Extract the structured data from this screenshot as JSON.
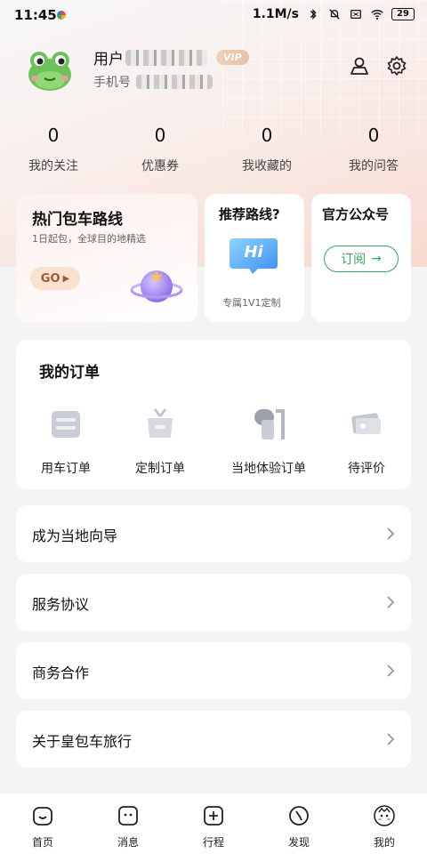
{
  "status_bar": {
    "time": "11:45",
    "network_speed": "1.1M/s",
    "battery": "29"
  },
  "profile": {
    "name_prefix": "用户",
    "vip_badge": "VIP",
    "phone_prefix": "手机号"
  },
  "stats": [
    {
      "value": "0",
      "label": "我的关注"
    },
    {
      "value": "0",
      "label": "优惠券"
    },
    {
      "value": "0",
      "label": "我收藏的"
    },
    {
      "value": "0",
      "label": "我的问答"
    }
  ],
  "promo": {
    "hot_routes": {
      "title": "热门包车路线",
      "subtitle": "1日起包，全球目的地精选",
      "button": "GO"
    },
    "recommend": {
      "title": "推荐路线?",
      "bubble": "Hi",
      "caption": "专属1V1定制"
    },
    "official": {
      "title": "官方公众号",
      "button": "订阅"
    }
  },
  "orders": {
    "title": "我的订单",
    "items": [
      {
        "label": "用车订单",
        "icon": "car-order-icon"
      },
      {
        "label": "定制订单",
        "icon": "gift-order-icon"
      },
      {
        "label": "当地体验订单",
        "icon": "experience-order-icon"
      },
      {
        "label": "待评价",
        "icon": "ticket-review-icon"
      }
    ]
  },
  "menu": [
    {
      "label": "成为当地向导"
    },
    {
      "label": "服务协议"
    },
    {
      "label": "商务合作"
    },
    {
      "label": "关于皇包车旅行"
    }
  ],
  "bottom_nav": [
    {
      "label": "首页",
      "icon": "home-icon"
    },
    {
      "label": "消息",
      "icon": "message-icon"
    },
    {
      "label": "行程",
      "icon": "trip-icon"
    },
    {
      "label": "发现",
      "icon": "discover-icon"
    },
    {
      "label": "我的",
      "icon": "profile-icon",
      "active": true
    }
  ],
  "colors": {
    "accent_green": "#3aa565",
    "go_button_bg": "#f8e2cf",
    "go_button_text": "#9c5a36"
  }
}
